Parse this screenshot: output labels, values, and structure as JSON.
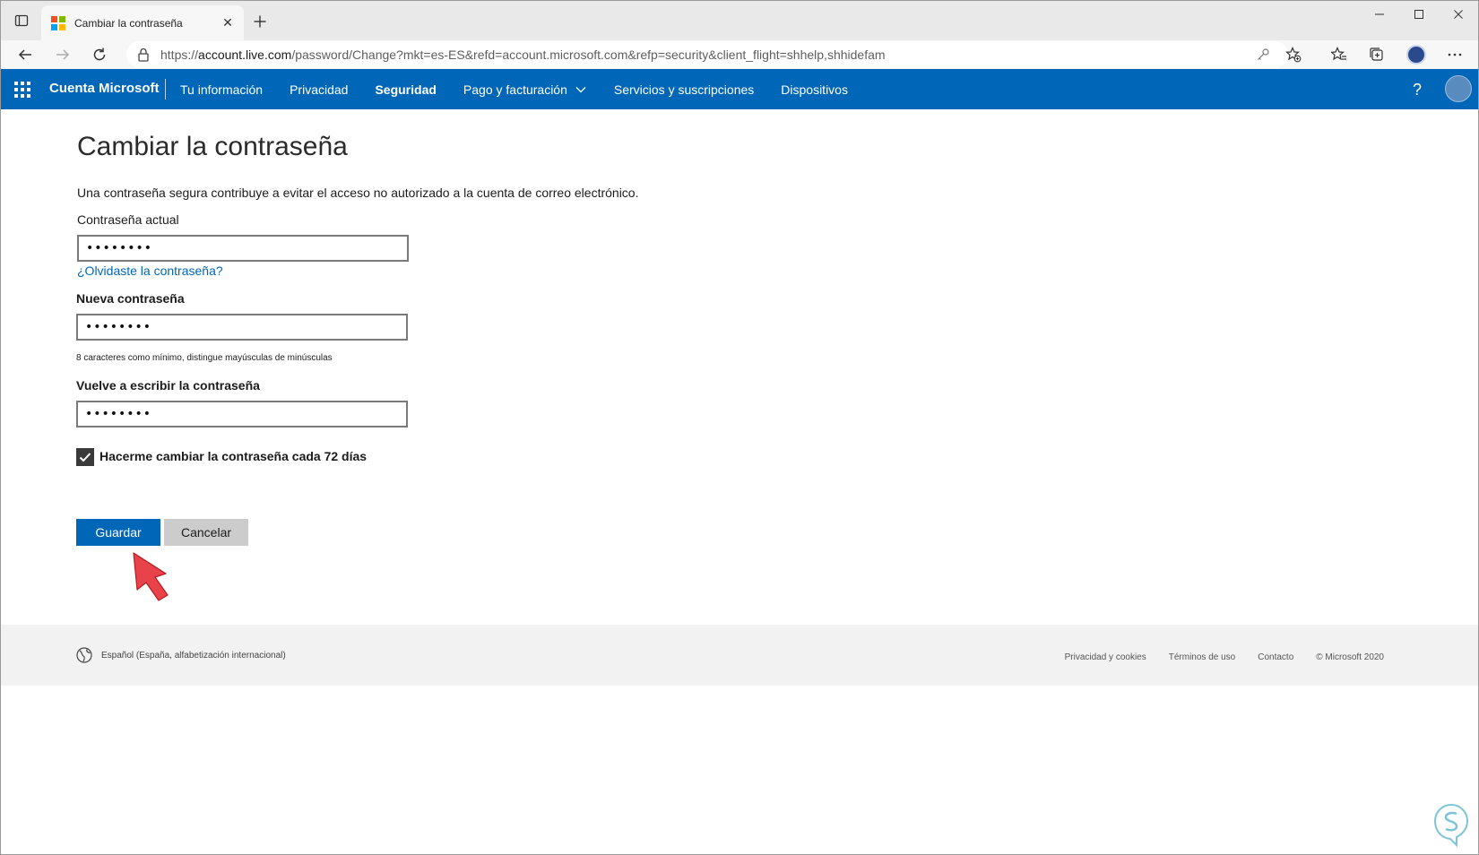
{
  "browser": {
    "tab_title": "Cambiar la contraseña",
    "url_prefix": "https://",
    "url_host": "account.live.com",
    "url_path": "/password/Change?mkt=es-ES&refd=account.microsoft.com&refp=security&client_flight=shhelp,shhidefam",
    "tab_close": "✕"
  },
  "header": {
    "brand": "Cuenta Microsoft",
    "nav": [
      {
        "label": "Tu información"
      },
      {
        "label": "Privacidad"
      },
      {
        "label": "Seguridad"
      },
      {
        "label": "Pago y facturación"
      },
      {
        "label": "Servicios y suscripciones"
      },
      {
        "label": "Dispositivos"
      }
    ],
    "help": "?"
  },
  "main": {
    "title": "Cambiar la contraseña",
    "intro": "Una contraseña segura contribuye a evitar el acceso no autorizado a la cuenta de correo electrónico.",
    "current_password": {
      "label": "Contraseña actual",
      "value": "••••••••"
    },
    "forgot_link": "¿Olvidaste la contraseña?",
    "new_password": {
      "label": "Nueva contraseña",
      "value": "••••••••"
    },
    "hint": "8 caracteres como mínimo, distingue mayúsculas de minúsculas",
    "confirm_password": {
      "label": "Vuelve a escribir la contraseña",
      "value": "••••••••"
    },
    "checkbox": {
      "label": "Hacerme cambiar la contraseña cada 72 días",
      "checked": true
    },
    "save_label": "Guardar",
    "cancel_label": "Cancelar"
  },
  "footer": {
    "language": "Español (España, alfabetización internacional)",
    "links": [
      "Privacidad y cookies",
      "Términos de uso",
      "Contacto"
    ],
    "copyright": "© Microsoft 2020"
  },
  "colors": {
    "accent": "#0067b8",
    "footer_bg": "#f2f2f2",
    "annotation_arrow": "#e8424a"
  }
}
